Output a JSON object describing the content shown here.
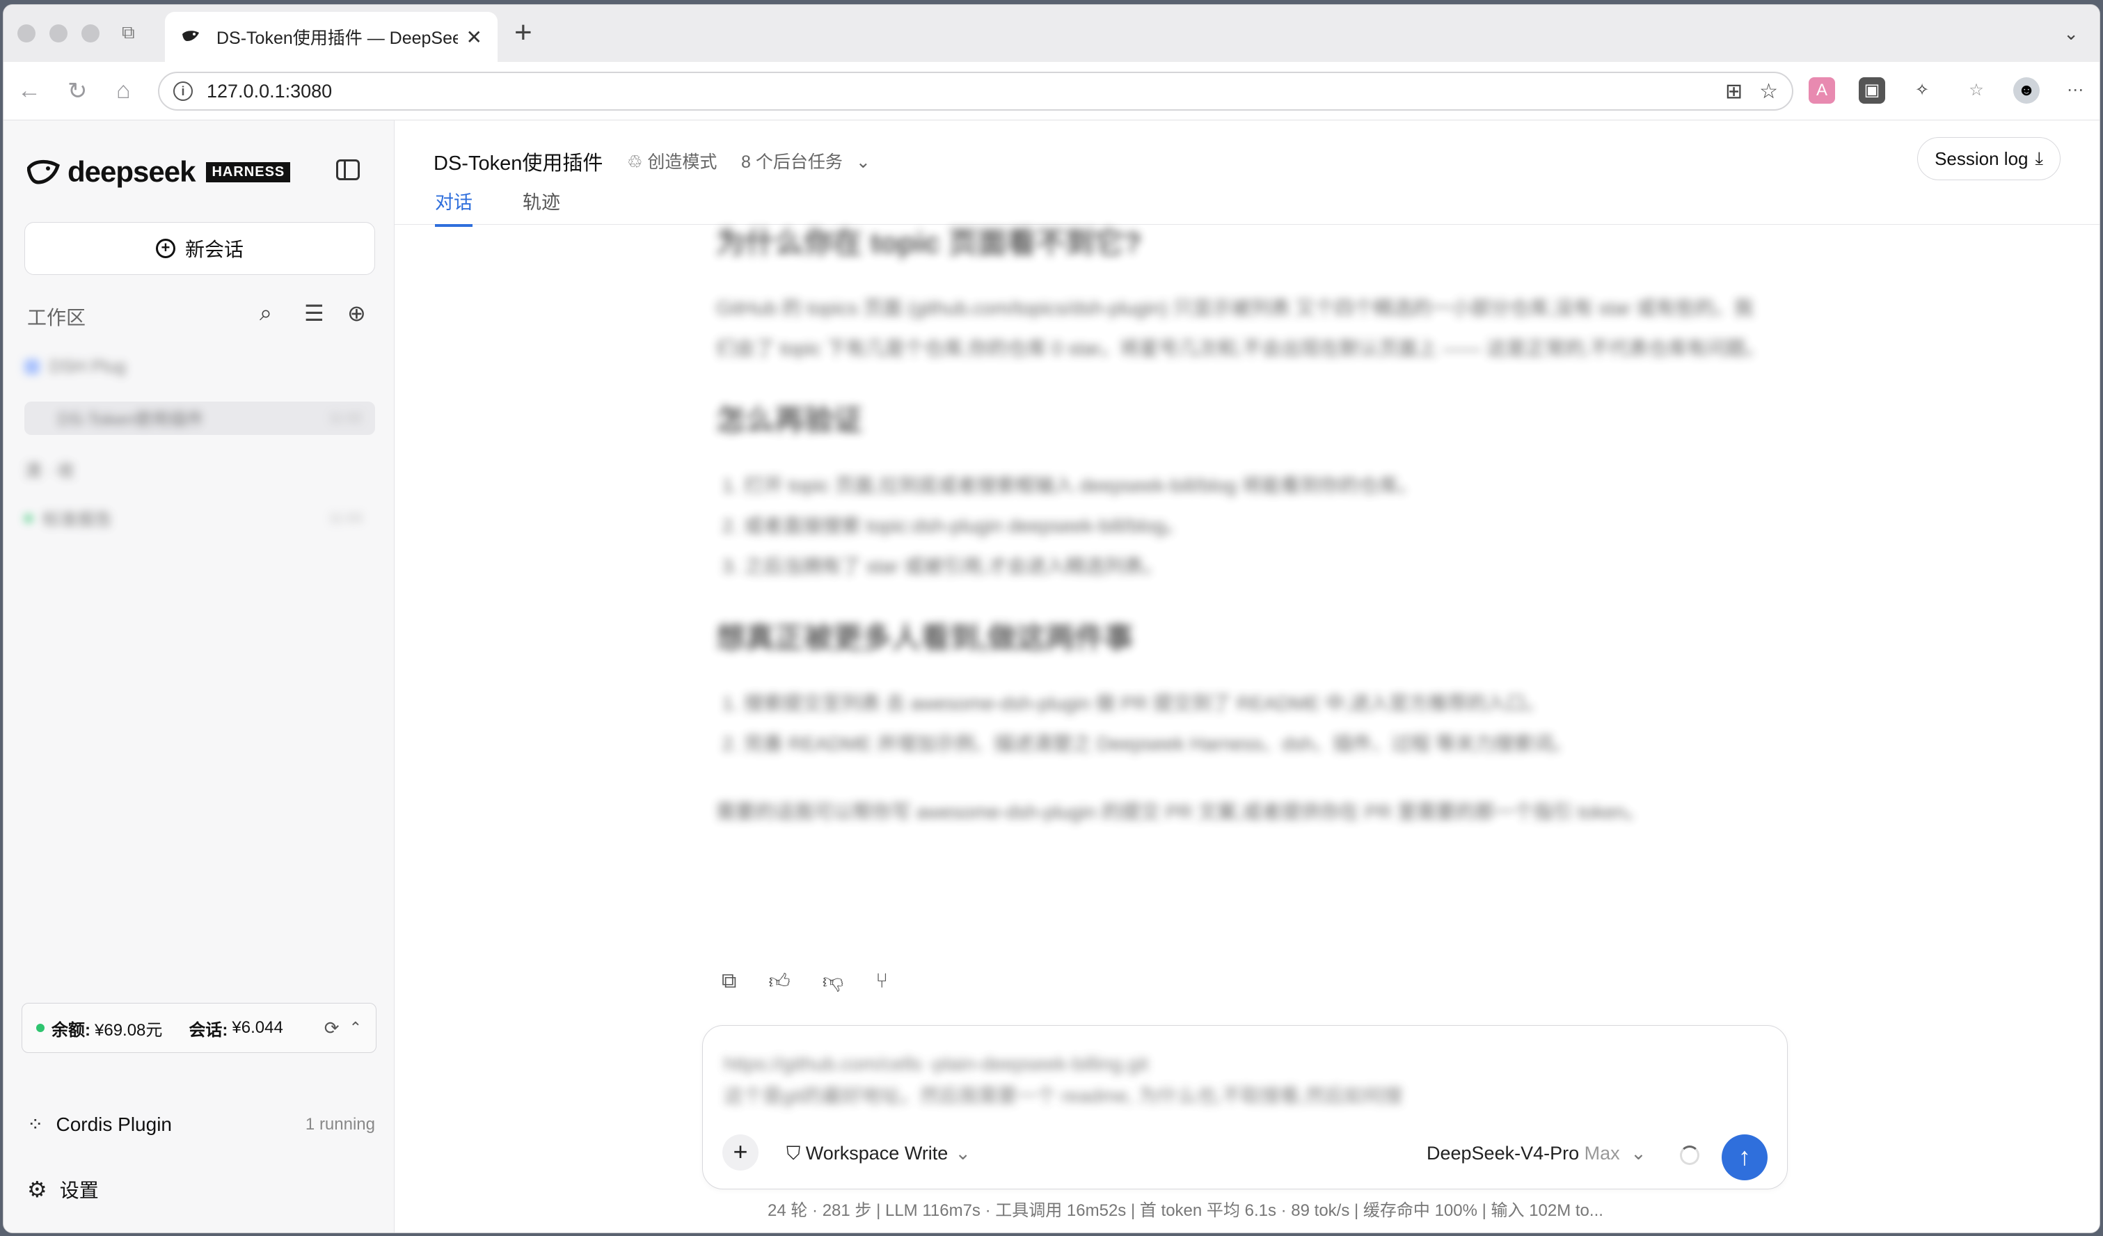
{
  "browser": {
    "tab_title": "DS-Token使用插件 — DeepSeek",
    "url": "127.0.0.1:3080"
  },
  "sidebar": {
    "brand_name": "deepseek",
    "brand_badge": "HARNESS",
    "new_chat_label": "新会话",
    "workspace_label": "工作区",
    "workspace_items": [
      {
        "label": "DSH Plug",
        "time": ""
      },
      {
        "label": "DS-Token使用插件",
        "time": "11:02"
      },
      {
        "label": "清 · 收",
        "time": ""
      },
      {
        "label": "标准报告",
        "time": "11:03"
      }
    ],
    "balance_label": "余额:",
    "balance_value": "¥69.08元",
    "session_label": "会话:",
    "session_value": "¥6.044",
    "plugin_name": "Cordis Plugin",
    "plugin_status": "1 running",
    "settings_label": "设置"
  },
  "header": {
    "title": "DS-Token使用插件",
    "mode": "创造模式",
    "tasks": "8 个后台任务",
    "session_log": "Session log",
    "tabs": [
      "对话",
      "轨迹"
    ]
  },
  "chat": {
    "h1": "为什么你在 topic 页面看不到它?",
    "p1": "GitHub 的 topics 页面 (github.com/topics/dsh-plugin) 只显示被列表 又个四个精选的一小部分仓库,没有 star 或有些的。我们会了 topic 下有几是个仓库,你的仓库 0 star。将星号几次和,不会出现在默认页面上 —— 这是正常的,不代表仓库有问题。",
    "h2": "怎么再验证",
    "list1": [
      "打开 topic 页面,拉到底或者搜索框输入 deepseek-bill/blog 将能看到你的仓库。",
      "或者直接搜索 topic:dsh-plugin deepseek-bill/blog。",
      "之后当拥有了 star 或被引用,才会进入精选列表。"
    ],
    "h3": "想真正被更多人看到,做这两件事",
    "list2": [
      "搜索提交至列表 去 awesome-dsh-plugin 做 PR 提交到了 README 中,进入官方推荐的入口。",
      "完善 README 并增加示例、描述清楚之 Deepseek Harness、dsh、插件、过程 等关力搜索词。"
    ],
    "p2": "需要的话我可以帮你写 awesome-dsh-plugin 的提交 PR 文案,或者提供你在 PR 里需要的那一个指引 token。"
  },
  "composer": {
    "draft_line1": "https://github.com/cells -plain-deepseek-billing.git",
    "draft_line2": "这个是git的最好地址。然后我需要一个 readme, 为什么也,不取搜看,然后如何搜",
    "permission": "Workspace Write",
    "model": "DeepSeek-V4-Pro",
    "model_level": "Max"
  },
  "stats": "24 轮 · 281 步   |   LLM 116m7s · 工具调用 16m52s   |   首 token 平均 6.1s · 89 tok/s   |   缓存命中 100%   |   输入 102M to..."
}
